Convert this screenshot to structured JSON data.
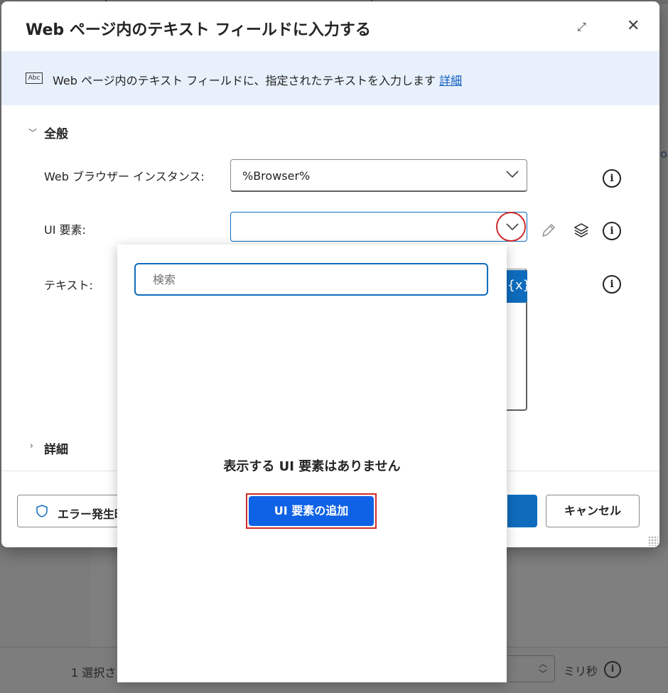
{
  "dialog": {
    "title": "Web ページ内のテキスト フィールドに入力する",
    "banner_text": "Web ページ内のテキスト フィールドに、指定されたテキストを入力します",
    "banner_link": "詳細",
    "banner_icon_label": "Abc"
  },
  "sections": {
    "general": "全般",
    "advanced": "詳細"
  },
  "fields": {
    "browser_label": "Web ブラウザー インスタンス:",
    "browser_value": "%Browser%",
    "ui_element_label": "UI 要素:",
    "ui_element_value": "",
    "text_label": "テキスト:",
    "variable_button": "{x}"
  },
  "popup": {
    "search_placeholder": "検索",
    "empty_message": "表示する UI 要素はありません",
    "add_button": "UI 要素の追加"
  },
  "footer": {
    "error_button": "エラー発生時",
    "cancel_button": "キャンセル"
  },
  "background": {
    "status_text": "1 選択さ",
    "ms_label": "ミリ秒",
    "right_edge_text": "og"
  },
  "colors": {
    "accent": "#0f6cbd",
    "add_button": "#0f62e6",
    "highlight": "#d12b2b",
    "banner": "#e8f0fb"
  }
}
